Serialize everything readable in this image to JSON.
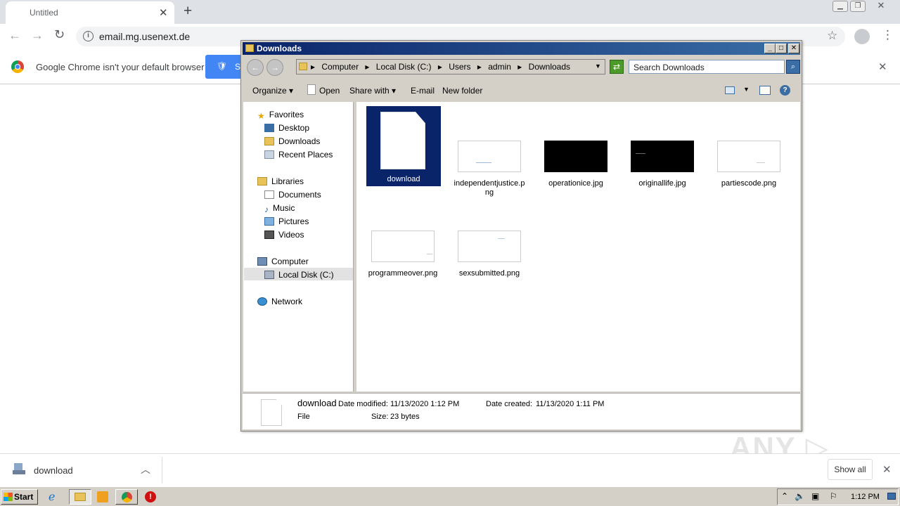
{
  "chrome": {
    "tab_title": "Untitled",
    "new_tab": "+",
    "url": "email.mg.usenext.de",
    "infobar_text": "Google Chrome isn't your default browser",
    "set_default_label": "S"
  },
  "shelf": {
    "download_name": "download",
    "show_all": "Show all"
  },
  "explorer": {
    "title": "Downloads",
    "breadcrumb": [
      "Computer",
      "Local Disk (C:)",
      "Users",
      "admin",
      "Downloads"
    ],
    "search_placeholder": "Search Downloads",
    "commands": {
      "organize": "Organize",
      "open": "Open",
      "share_with": "Share with",
      "email": "E-mail",
      "new_folder": "New folder"
    },
    "nav": {
      "favorites": "Favorites",
      "desktop": "Desktop",
      "downloads": "Downloads",
      "recent_places": "Recent Places",
      "libraries": "Libraries",
      "documents": "Documents",
      "music": "Music",
      "pictures": "Pictures",
      "videos": "Videos",
      "computer": "Computer",
      "local_disk": "Local Disk (C:)",
      "network": "Network"
    },
    "files": [
      {
        "name": "download"
      },
      {
        "name": "independentjustice.png"
      },
      {
        "name": "operationice.jpg"
      },
      {
        "name": "originallife.jpg"
      },
      {
        "name": "partiescode.png"
      },
      {
        "name": "programmeover.png"
      },
      {
        "name": "sexsubmitted.png"
      }
    ],
    "details": {
      "name": "download",
      "type": "File",
      "date_modified_label": "Date modified:",
      "date_modified": "11/13/2020 1:12 PM",
      "date_created_label": "Date created:",
      "date_created": "11/13/2020 1:11 PM",
      "size_label": "Size:",
      "size": "23 bytes"
    }
  },
  "taskbar": {
    "start": "Start",
    "clock": "1:12 PM"
  },
  "watermark": "ANY RUN"
}
